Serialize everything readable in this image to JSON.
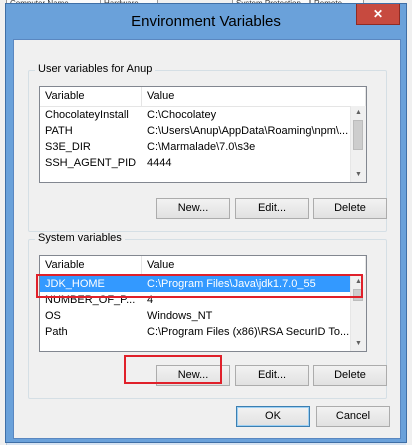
{
  "background": {
    "tabs": [
      "Computer Name",
      "Hardware",
      "System Protection",
      "Remote"
    ]
  },
  "dialog": {
    "title": "Environment Variables",
    "close_icon": "✕"
  },
  "user_vars": {
    "label": "User variables for Anup",
    "columns": [
      "Variable",
      "Value"
    ],
    "rows": [
      {
        "variable": "ChocolateyInstall",
        "value": "C:\\Chocolatey"
      },
      {
        "variable": "PATH",
        "value": "C:\\Users\\Anup\\AppData\\Roaming\\npm\\..."
      },
      {
        "variable": "S3E_DIR",
        "value": "C:\\Marmalade\\7.0\\s3e"
      },
      {
        "variable": "SSH_AGENT_PID",
        "value": "4444"
      }
    ],
    "buttons": {
      "new": "New...",
      "edit": "Edit...",
      "delete": "Delete"
    }
  },
  "system_vars": {
    "label": "System variables",
    "columns": [
      "Variable",
      "Value"
    ],
    "rows": [
      {
        "variable": "JDK_HOME",
        "value": "C:\\Program Files\\Java\\jdk1.7.0_55",
        "selected": true
      },
      {
        "variable": "NUMBER_OF_P...",
        "value": "4"
      },
      {
        "variable": "OS",
        "value": "Windows_NT"
      },
      {
        "variable": "Path",
        "value": "C:\\Program Files (x86)\\RSA SecurID To..."
      }
    ],
    "buttons": {
      "new": "New...",
      "edit": "Edit...",
      "delete": "Delete"
    }
  },
  "footer": {
    "ok": "OK",
    "cancel": "Cancel"
  },
  "colors": {
    "selection": "#3399ff",
    "highlight": "#e0202a",
    "title_bar": "#6aa1da",
    "close_button": "#c74a3f"
  }
}
